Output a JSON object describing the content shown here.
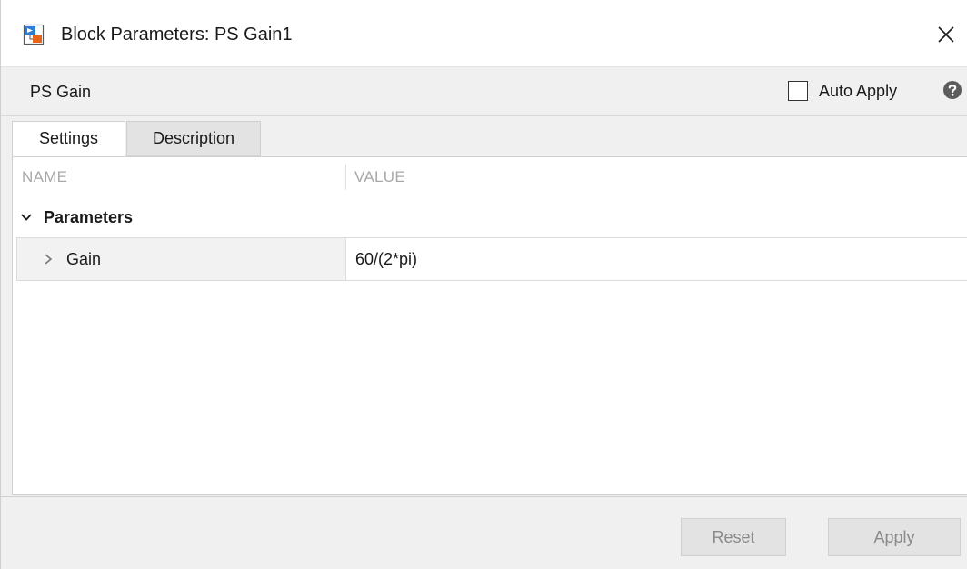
{
  "window": {
    "title": "Block Parameters: PS Gain1"
  },
  "header": {
    "block_name": "PS Gain",
    "auto_apply_label": "Auto Apply",
    "auto_apply_checked": false
  },
  "tabs": [
    {
      "label": "Settings",
      "active": true
    },
    {
      "label": "Description",
      "active": false
    }
  ],
  "table": {
    "columns": {
      "name": "NAME",
      "value": "VALUE"
    },
    "group": {
      "label": "Parameters",
      "expanded": true
    },
    "rows": [
      {
        "name": "Gain",
        "value": "60/(2*pi)"
      }
    ]
  },
  "footer": {
    "reset_label": "Reset",
    "apply_label": "Apply"
  },
  "icons": {
    "app": "simulink-block-icon",
    "close": "close-icon",
    "help": "help-icon",
    "group_chevron": "chevron-down-icon",
    "row_chevron": "chevron-right-icon"
  },
  "colors": {
    "app_icon_blue": "#2a7fd4",
    "app_icon_orange": "#e8641b",
    "disabled_button_text": "#8a8a8a"
  }
}
